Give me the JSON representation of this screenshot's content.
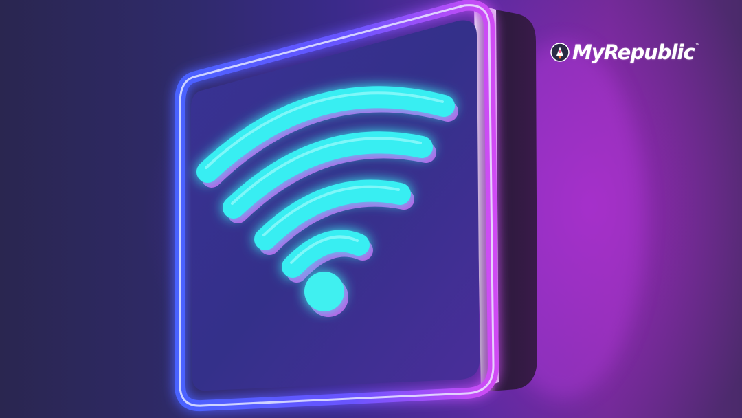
{
  "brand": {
    "name": "MyRepublic",
    "trademark": "™",
    "logo_icon": "rocket-icon"
  },
  "scene": {
    "subject": "wifi-icon",
    "colors": {
      "background": "#2f2a6a",
      "wifi_glow": "#3ff0f0",
      "frame_blue": "#4a5cff",
      "frame_magenta": "#c43cf0"
    }
  }
}
